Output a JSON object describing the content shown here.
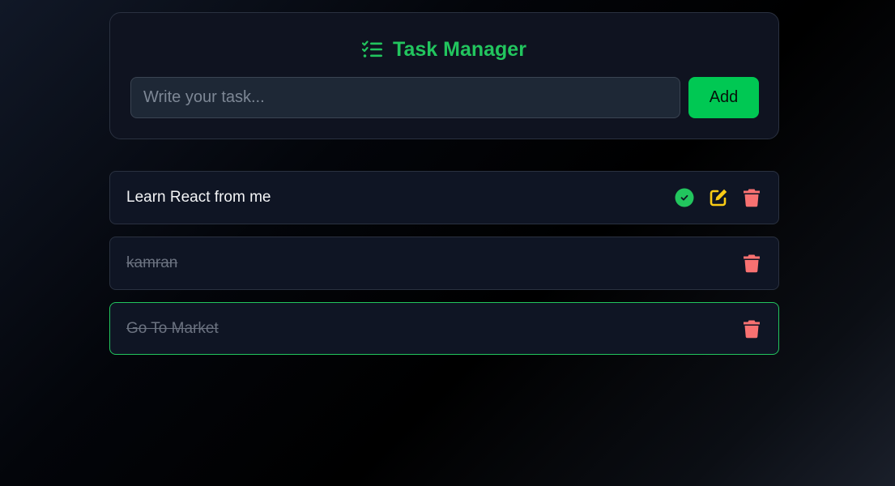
{
  "header": {
    "title": "Task Manager",
    "icon": "list-check-icon",
    "title_color": "#22c55e"
  },
  "new_task": {
    "placeholder": "Write your task...",
    "value": "",
    "add_label": "Add",
    "add_color": "#00c853"
  },
  "tasks": [
    {
      "text": "Learn React from me",
      "completed": false,
      "actions": [
        "check-icon",
        "edit-icon",
        "trash-icon"
      ]
    },
    {
      "text": "kamran",
      "completed": true,
      "actions": [
        "trash-icon"
      ]
    },
    {
      "text": "Go To Market",
      "completed": true,
      "highlighted": true,
      "actions": [
        "trash-icon"
      ]
    }
  ],
  "colors": {
    "check": "#22c55e",
    "edit": "#facc15",
    "delete": "#f87171"
  }
}
